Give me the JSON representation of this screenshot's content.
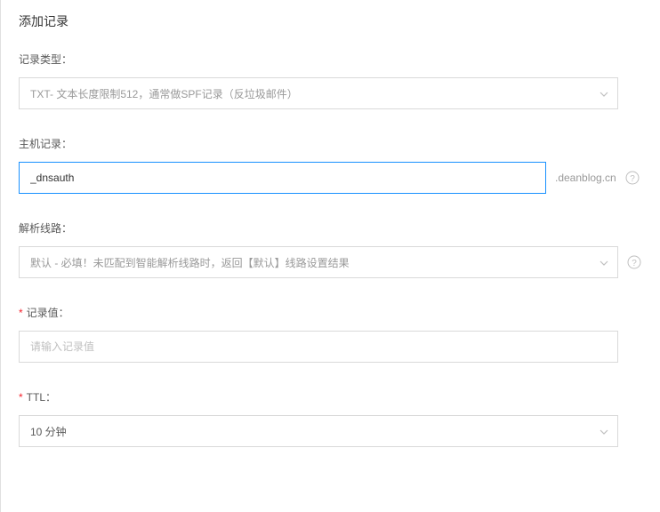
{
  "header": {
    "title": "添加记录"
  },
  "labels": {
    "record_type": "记录类型：",
    "host_record": "主机记录：",
    "resolution_line": "解析线路：",
    "record_value": "记录值：",
    "ttl": "TTL："
  },
  "fields": {
    "record_type": {
      "value": "TXT- 文本长度限制512，通常做SPF记录（反垃圾邮件）"
    },
    "host_record": {
      "value": "_dnsauth",
      "suffix": ".deanblog.cn"
    },
    "resolution_line": {
      "value": "默认 - 必填！未匹配到智能解析线路时，返回【默认】线路设置结果"
    },
    "record_value": {
      "placeholder": "请输入记录值",
      "value": ""
    },
    "ttl": {
      "value": "10 分钟"
    }
  }
}
